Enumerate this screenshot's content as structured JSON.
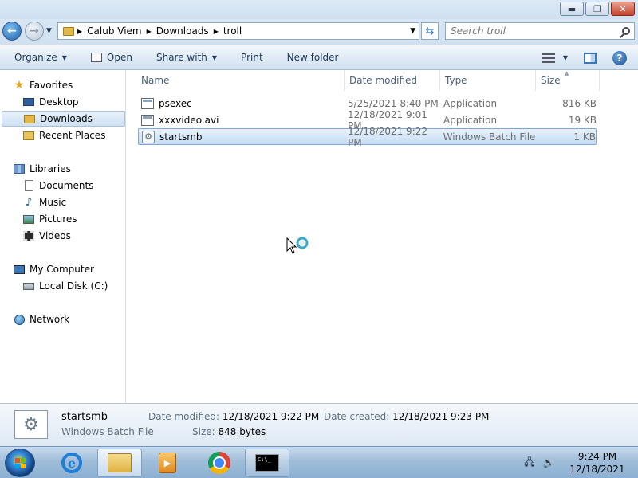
{
  "window": {
    "minimize_glyph": "▬",
    "maximize_glyph": "❐",
    "close_glyph": "✕"
  },
  "address": {
    "crumbs": [
      "Calub Viem",
      "Downloads",
      "troll"
    ],
    "separator": "▶",
    "search_placeholder": "Search troll"
  },
  "toolbar": {
    "organize": "Organize",
    "open": "Open",
    "share_with": "Share with",
    "print": "Print",
    "new_folder": "New folder"
  },
  "nav": {
    "favorites": "Favorites",
    "desktop": "Desktop",
    "downloads": "Downloads",
    "recent_places": "Recent Places",
    "libraries": "Libraries",
    "documents": "Documents",
    "music": "Music",
    "pictures": "Pictures",
    "videos": "Videos",
    "my_computer": "My Computer",
    "local_disk": "Local Disk (C:)",
    "network": "Network"
  },
  "columns": {
    "name": "Name",
    "date_modified": "Date modified",
    "type": "Type",
    "size": "Size"
  },
  "files": [
    {
      "name": "psexec",
      "date": "5/25/2021 8:40 PM",
      "type": "Application",
      "size": "816 KB",
      "icon": "application-icon"
    },
    {
      "name": "xxxvideo.avi",
      "date": "12/18/2021 9:01 PM",
      "type": "Application",
      "size": "19 KB",
      "icon": "application-icon"
    },
    {
      "name": "startsmb",
      "date": "12/18/2021 9:22 PM",
      "type": "Windows Batch File",
      "size": "1 KB",
      "icon": "batch-file-icon",
      "selected": true
    }
  ],
  "details": {
    "name": "startsmb",
    "type": "Windows Batch File",
    "date_modified_label": "Date modified:",
    "date_modified": "12/18/2021 9:22 PM",
    "date_created_label": "Date created:",
    "date_created": "12/18/2021 9:23 PM",
    "size_label": "Size:",
    "size": "848 bytes"
  },
  "taskbar": {
    "time": "9:24 PM",
    "date": "12/18/2021",
    "cmd_icon_text": "C:\\_"
  },
  "colors": {
    "accent": "#1e395b",
    "selection": "#c5dcf5"
  }
}
